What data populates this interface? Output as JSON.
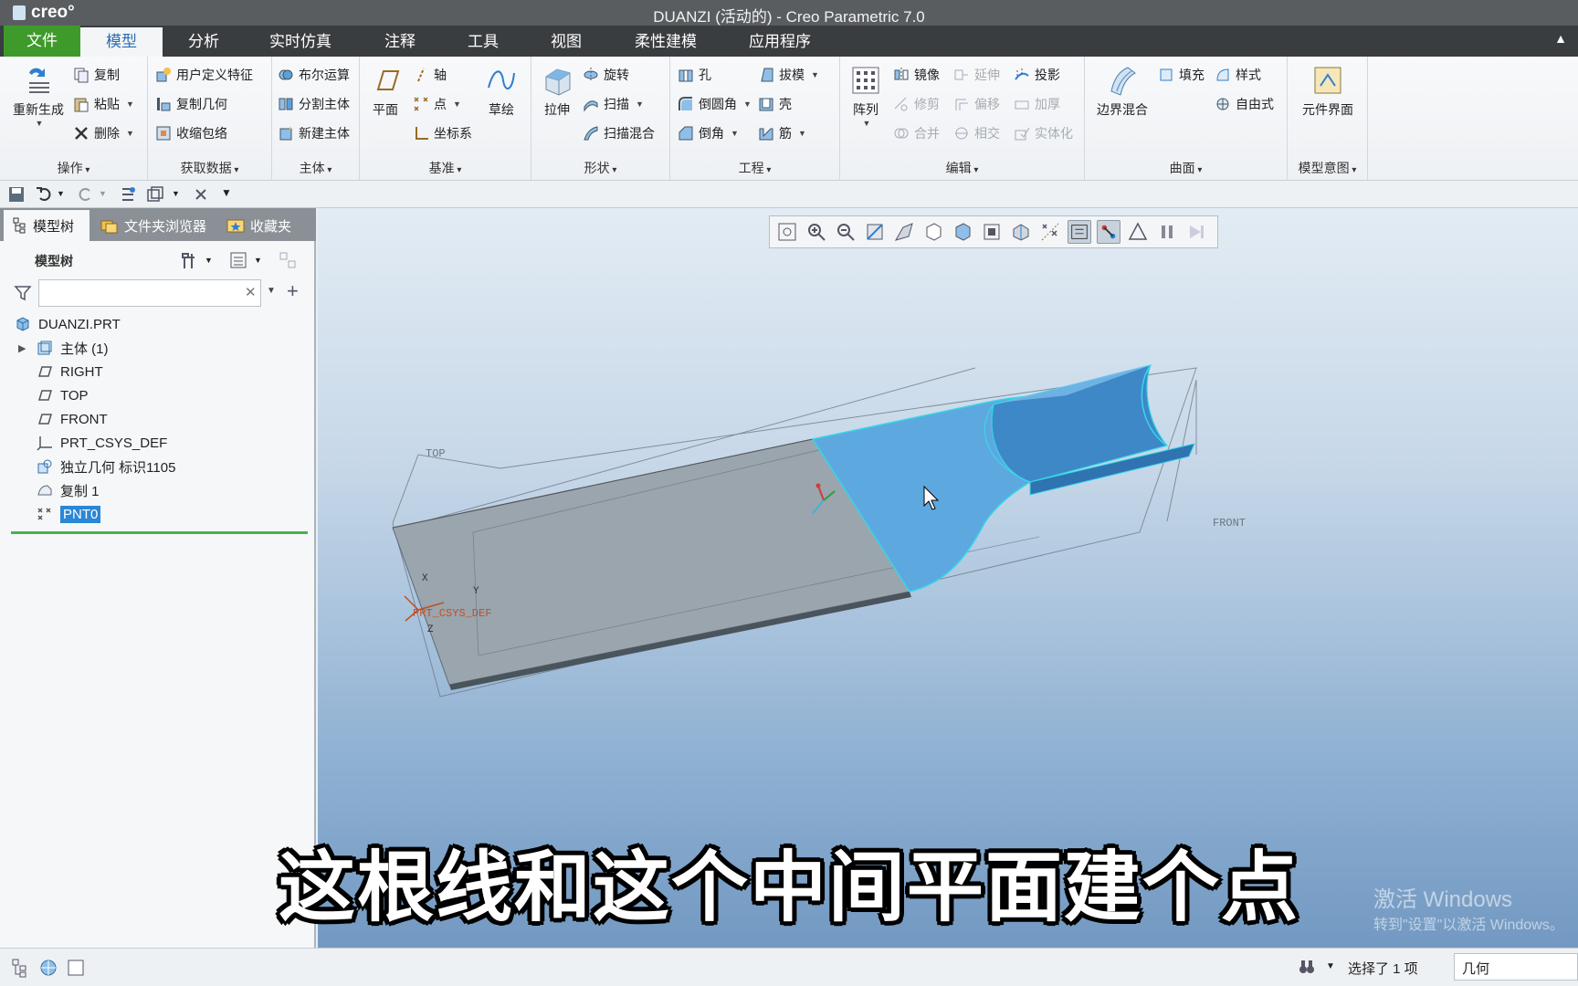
{
  "app": {
    "logo_text": "creo°",
    "window_title": "DUANZI (活动的) - Creo Parametric 7.0"
  },
  "menu": {
    "tabs": [
      "文件",
      "模型",
      "分析",
      "实时仿真",
      "注释",
      "工具",
      "视图",
      "柔性建模",
      "应用程序"
    ],
    "active": "模型"
  },
  "ribbon": {
    "operations": {
      "label": "操作",
      "regenerate": "重新生成",
      "copy": "复制",
      "paste": "粘贴",
      "delete": "删除"
    },
    "get_data": {
      "label": "获取数据",
      "udf": "用户定义特征",
      "copy_geom": "复制几何",
      "shrinkwrap": "收缩包络"
    },
    "body": {
      "label": "主体",
      "boolean": "布尔运算",
      "split_body": "分割主体",
      "new_body": "新建主体"
    },
    "datum": {
      "label": "基准",
      "plane": "平面",
      "axis": "轴",
      "point": "点",
      "csys": "坐标系",
      "sketch": "草绘"
    },
    "shapes": {
      "label": "形状",
      "extrude": "拉伸",
      "revolve": "旋转",
      "sweep": "扫描",
      "swept_blend": "扫描混合"
    },
    "engineering": {
      "label": "工程",
      "hole": "孔",
      "round": "倒圆角",
      "chamfer": "倒角",
      "draft": "拔模",
      "shell": "壳",
      "rib": "筋"
    },
    "editing": {
      "label": "编辑",
      "pattern": "阵列",
      "mirror": "镜像",
      "trim": "修剪",
      "merge": "合并",
      "extend": "延伸",
      "offset": "偏移",
      "intersect": "相交",
      "project": "投影",
      "thicken": "加厚",
      "solidify": "实体化"
    },
    "surfaces": {
      "label": "曲面",
      "boundary_blend": "边界混合",
      "fill": "填充",
      "style": "样式",
      "freestyle": "自由式"
    },
    "model_intent": {
      "label": "模型意图",
      "component_interface": "元件界面"
    }
  },
  "left_panel": {
    "tabs": [
      "模型树",
      "文件夹浏览器",
      "收藏夹"
    ],
    "tree_header": "模型树",
    "filter_value": "",
    "tree": [
      {
        "label": "DUANZI.PRT",
        "icon": "part-icon",
        "indent": 0
      },
      {
        "label": "主体 (1)",
        "icon": "body-icon",
        "indent": 1,
        "expandable": true
      },
      {
        "label": "RIGHT",
        "icon": "datum-plane-icon",
        "indent": 1
      },
      {
        "label": "TOP",
        "icon": "datum-plane-icon",
        "indent": 1
      },
      {
        "label": "FRONT",
        "icon": "datum-plane-icon",
        "indent": 1
      },
      {
        "label": "PRT_CSYS_DEF",
        "icon": "csys-icon",
        "indent": 1
      },
      {
        "label": "独立几何 标识1105",
        "icon": "independent-geometry-icon",
        "indent": 1
      },
      {
        "label": "复制 1",
        "icon": "copy-geometry-icon",
        "indent": 1
      },
      {
        "label": "PNT0",
        "icon": "datum-point-icon",
        "indent": 1,
        "selected": true
      }
    ]
  },
  "viewport": {
    "datum_labels": {
      "top": "TOP",
      "front": "FRONT",
      "csys": "PRT_CSYS_DEF",
      "x": "X",
      "y": "Y",
      "z": "Z"
    },
    "colors": {
      "surface": "#5ea8e0",
      "surface_edge": "#37d6e8",
      "gray_body": "#9aa5ae"
    }
  },
  "subtitle": "这根线和这个中间平面建个点",
  "watermark": {
    "line1": "激活 Windows",
    "line2": "转到\"设置\"以激活 Windows。"
  },
  "status": {
    "selection": "选择了 1 项",
    "filter": "几何"
  }
}
